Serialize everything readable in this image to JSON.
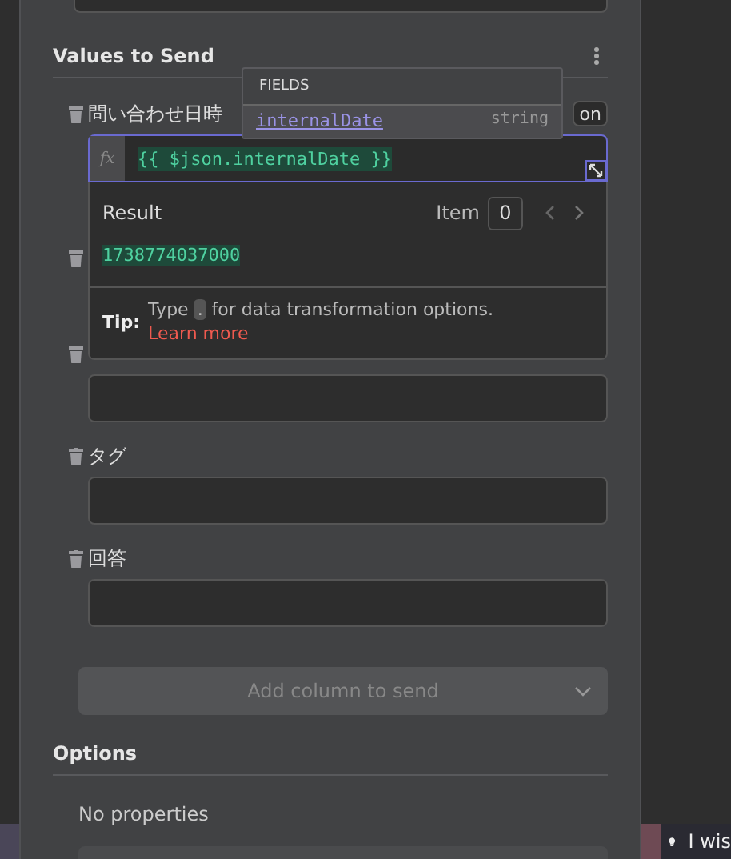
{
  "values_section": {
    "title": "Values to Send",
    "rows": [
      {
        "kind": "expression",
        "label": "問い合わせ日時",
        "mode_button": "on",
        "expression": "{{ $json.internalDate }}",
        "fx": "fx"
      },
      {
        "kind": "covered"
      },
      {
        "kind": "covered_label"
      },
      {
        "kind": "field",
        "label": "タグ"
      },
      {
        "kind": "field",
        "label": "回答"
      }
    ],
    "add_button": "Add column to send"
  },
  "fields_popup": {
    "title": "FIELDS",
    "items": [
      {
        "name": "internalDate",
        "type": "string"
      }
    ]
  },
  "result_panel": {
    "title": "Result",
    "item_label": "Item",
    "item_index": "0",
    "value": "1738774037000",
    "tip": {
      "label": "Tip:",
      "before": "Type",
      "key": ".",
      "after": "for data transformation options.",
      "link": "Learn more"
    }
  },
  "options_section": {
    "title": "Options",
    "empty_text": "No properties"
  },
  "notice": {
    "text": "I wis"
  }
}
